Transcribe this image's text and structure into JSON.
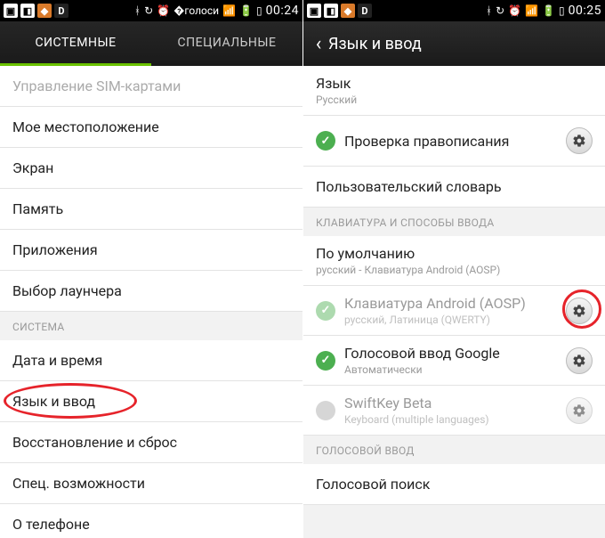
{
  "left": {
    "status_time": "00:24",
    "tabs": {
      "system": "СИСТЕМНЫЕ",
      "special": "СПЕЦИАЛЬНЫЕ"
    },
    "items": {
      "sim": "Управление SIM-картами",
      "location": "Мое местоположение",
      "display": "Экран",
      "memory": "Память",
      "apps": "Приложения",
      "launcher": "Выбор лаунчера"
    },
    "section_system": "СИСТЕМА",
    "items2": {
      "datetime": "Дата и время",
      "lang": "Язык и ввод",
      "reset": "Восстановление и сброс",
      "accessibility": "Спец. возможности",
      "about": "О телефоне"
    }
  },
  "right": {
    "status_time": "00:25",
    "title": "Язык и ввод",
    "lang_label": "Язык",
    "lang_value": "Русский",
    "spellcheck": "Проверка правописания",
    "userdict": "Пользовательский словарь",
    "section_keyboards": "КЛАВИАТУРА И СПОСОБЫ ВВОДА",
    "default_label": "По умолчанию",
    "default_value": "русский - Клавиатура Android (AOSP)",
    "kb_aosp": "Клавиатура Android (AOSP)",
    "kb_aosp_sub": "русский, Латиница (QWERTY)",
    "kb_google": "Голосовой ввод Google",
    "kb_google_sub": "Автоматически",
    "kb_swift": "SwiftKey Beta",
    "kb_swift_sub": "Keyboard (multiple languages)",
    "section_voice": "ГОЛОСОВОЙ ВВОД",
    "voice_search": "Голосовой поиск"
  }
}
